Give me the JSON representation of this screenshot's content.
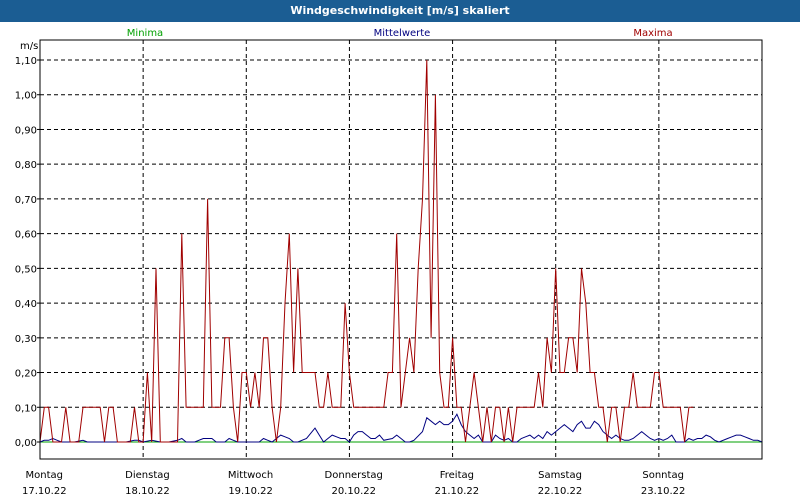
{
  "window_title": "Windgeschwindigkeit [m/s] skaliert",
  "colors": {
    "titlebar": "#1b5d93",
    "minima": "#00a000",
    "mittelwerte": "#000080",
    "maxima": "#a00000",
    "grid": "#000000"
  },
  "chart_data": {
    "type": "line",
    "title": "Windgeschwindigkeit [m/s] skaliert",
    "ylabel": "m/s",
    "ylim": [
      0,
      1.1
    ],
    "y_ticks": [
      "0,00",
      "0,10",
      "0,20",
      "0,30",
      "0,40",
      "0,50",
      "0,60",
      "0,70",
      "0,80",
      "0,90",
      "1,00",
      "1,10"
    ],
    "x_range_hours": [
      0,
      168
    ],
    "days": [
      {
        "weekday": "Montag",
        "date": "17.10.22"
      },
      {
        "weekday": "Dienstag",
        "date": "18.10.22"
      },
      {
        "weekday": "Mittwoch",
        "date": "19.10.22"
      },
      {
        "weekday": "Donnerstag",
        "date": "20.10.22"
      },
      {
        "weekday": "Freitag",
        "date": "21.10.22"
      },
      {
        "weekday": "Samstag",
        "date": "22.10.22"
      },
      {
        "weekday": "Sonntag",
        "date": "23.10.22"
      }
    ],
    "grid": true,
    "legend_position": "top",
    "series": [
      {
        "name": "Minima",
        "color": "#00a000",
        "points": [
          [
            0,
            0
          ],
          [
            168,
            0
          ]
        ]
      },
      {
        "name": "Mittelwerte",
        "color": "#000080",
        "points": [
          [
            0,
            0
          ],
          [
            1,
            0.005
          ],
          [
            2,
            0.005
          ],
          [
            3,
            0.01
          ],
          [
            4,
            0.005
          ],
          [
            5,
            0
          ],
          [
            8,
            0
          ],
          [
            10,
            0.005
          ],
          [
            11,
            0
          ],
          [
            20,
            0
          ],
          [
            22,
            0.005
          ],
          [
            23,
            0.005
          ],
          [
            24,
            0
          ],
          [
            26,
            0.005
          ],
          [
            28,
            0
          ],
          [
            30,
            0
          ],
          [
            32,
            0.005
          ],
          [
            33,
            0.01
          ],
          [
            34,
            0
          ],
          [
            36,
            0
          ],
          [
            38,
            0.01
          ],
          [
            40,
            0.01
          ],
          [
            41,
            0
          ],
          [
            43,
            0
          ],
          [
            44,
            0.01
          ],
          [
            45,
            0.005
          ],
          [
            46,
            0
          ],
          [
            48,
            0
          ],
          [
            51,
            0
          ],
          [
            52,
            0.01
          ],
          [
            53,
            0.005
          ],
          [
            54,
            0
          ],
          [
            55,
            0.01
          ],
          [
            56,
            0.02
          ],
          [
            57,
            0.015
          ],
          [
            58,
            0.01
          ],
          [
            59,
            0
          ],
          [
            60,
            0
          ],
          [
            62,
            0.01
          ],
          [
            64,
            0.04
          ],
          [
            65,
            0.02
          ],
          [
            66,
            0
          ],
          [
            67,
            0.01
          ],
          [
            68,
            0.02
          ],
          [
            69,
            0.015
          ],
          [
            70,
            0.01
          ],
          [
            71,
            0.01
          ],
          [
            72,
            0
          ],
          [
            73,
            0.02
          ],
          [
            74,
            0.03
          ],
          [
            75,
            0.03
          ],
          [
            76,
            0.02
          ],
          [
            77,
            0.01
          ],
          [
            78,
            0.01
          ],
          [
            79,
            0.02
          ],
          [
            80,
            0.005
          ],
          [
            82,
            0.01
          ],
          [
            83,
            0.02
          ],
          [
            84,
            0.01
          ],
          [
            85,
            0
          ],
          [
            86,
            0
          ],
          [
            87,
            0.005
          ],
          [
            89,
            0.03
          ],
          [
            90,
            0.07
          ],
          [
            91,
            0.06
          ],
          [
            92,
            0.05
          ],
          [
            93,
            0.06
          ],
          [
            94,
            0.05
          ],
          [
            95,
            0.05
          ],
          [
            96,
            0.06
          ],
          [
            97,
            0.08
          ],
          [
            98,
            0.05
          ],
          [
            99,
            0.03
          ],
          [
            100,
            0.02
          ],
          [
            101,
            0.01
          ],
          [
            102,
            0.02
          ],
          [
            103,
            0
          ],
          [
            105,
            0
          ],
          [
            106,
            0.02
          ],
          [
            107,
            0.01
          ],
          [
            108,
            0.005
          ],
          [
            109,
            0.01
          ],
          [
            110,
            0
          ],
          [
            111,
            0
          ],
          [
            112,
            0.01
          ],
          [
            113,
            0.015
          ],
          [
            114,
            0.02
          ],
          [
            115,
            0.01
          ],
          [
            116,
            0.02
          ],
          [
            117,
            0.01
          ],
          [
            118,
            0.03
          ],
          [
            119,
            0.02
          ],
          [
            120,
            0.03
          ],
          [
            121,
            0.04
          ],
          [
            122,
            0.05
          ],
          [
            123,
            0.04
          ],
          [
            124,
            0.03
          ],
          [
            125,
            0.05
          ],
          [
            126,
            0.06
          ],
          [
            127,
            0.04
          ],
          [
            128,
            0.04
          ],
          [
            129,
            0.06
          ],
          [
            130,
            0.05
          ],
          [
            131,
            0.03
          ],
          [
            132,
            0.02
          ],
          [
            133,
            0.01
          ],
          [
            134,
            0.02
          ],
          [
            135,
            0.01
          ],
          [
            136,
            0.005
          ],
          [
            137,
            0.005
          ],
          [
            138,
            0.01
          ],
          [
            139,
            0.02
          ],
          [
            140,
            0.03
          ],
          [
            141,
            0.02
          ],
          [
            142,
            0.01
          ],
          [
            143,
            0.005
          ],
          [
            144,
            0.01
          ],
          [
            145,
            0.005
          ],
          [
            146,
            0.01
          ],
          [
            147,
            0.02
          ],
          [
            148,
            0
          ],
          [
            150,
            0
          ],
          [
            151,
            0.01
          ],
          [
            152,
            0.005
          ],
          [
            153,
            0.01
          ],
          [
            154,
            0.01
          ],
          [
            155,
            0.02
          ],
          [
            156,
            0.015
          ],
          [
            157,
            0.005
          ],
          [
            158,
            0
          ],
          [
            160,
            0.01
          ],
          [
            161,
            0.015
          ],
          [
            162,
            0.02
          ],
          [
            163,
            0.02
          ],
          [
            164,
            0.015
          ],
          [
            165,
            0.01
          ],
          [
            166,
            0.005
          ],
          [
            167,
            0.005
          ],
          [
            168,
            0
          ]
        ]
      },
      {
        "name": "Maxima",
        "color": "#a00000",
        "points": [
          [
            0,
            0
          ],
          [
            1,
            0.1
          ],
          [
            2,
            0.1
          ],
          [
            3,
            0
          ],
          [
            5,
            0
          ],
          [
            6,
            0.1
          ],
          [
            7,
            0
          ],
          [
            9,
            0
          ],
          [
            10,
            0.1
          ],
          [
            11,
            0.1
          ],
          [
            12,
            0.1
          ],
          [
            13,
            0.1
          ],
          [
            14,
            0.1
          ],
          [
            15,
            0
          ],
          [
            16,
            0.1
          ],
          [
            17,
            0.1
          ],
          [
            18,
            0
          ],
          [
            19,
            0
          ],
          [
            21,
            0
          ],
          [
            22,
            0.1
          ],
          [
            23,
            0
          ],
          [
            24,
            0
          ],
          [
            25,
            0.2
          ],
          [
            26,
            0
          ],
          [
            27,
            0.5
          ],
          [
            28,
            0
          ],
          [
            29,
            0
          ],
          [
            30,
            0
          ],
          [
            32,
            0
          ],
          [
            33,
            0.6
          ],
          [
            34,
            0.1
          ],
          [
            35,
            0.1
          ],
          [
            36,
            0.1
          ],
          [
            37,
            0.1
          ],
          [
            38,
            0.1
          ],
          [
            39,
            0.7
          ],
          [
            40,
            0.1
          ],
          [
            41,
            0.1
          ],
          [
            42,
            0.1
          ],
          [
            43,
            0.3
          ],
          [
            44,
            0.3
          ],
          [
            45,
            0.1
          ],
          [
            46,
            0
          ],
          [
            47,
            0.2
          ],
          [
            48,
            0.2
          ],
          [
            49,
            0.1
          ],
          [
            50,
            0.2
          ],
          [
            51,
            0.1
          ],
          [
            52,
            0.3
          ],
          [
            53,
            0.3
          ],
          [
            54,
            0.1
          ],
          [
            55,
            0
          ],
          [
            56,
            0.1
          ],
          [
            57,
            0.4
          ],
          [
            58,
            0.6
          ],
          [
            59,
            0.2
          ],
          [
            60,
            0.5
          ],
          [
            61,
            0.2
          ],
          [
            62,
            0.2
          ],
          [
            63,
            0.2
          ],
          [
            64,
            0.2
          ],
          [
            65,
            0.1
          ],
          [
            66,
            0.1
          ],
          [
            67,
            0.2
          ],
          [
            68,
            0.1
          ],
          [
            69,
            0.1
          ],
          [
            70,
            0.1
          ],
          [
            71,
            0.4
          ],
          [
            72,
            0.2
          ],
          [
            73,
            0.1
          ],
          [
            74,
            0.1
          ],
          [
            75,
            0.1
          ],
          [
            76,
            0.1
          ],
          [
            77,
            0.1
          ],
          [
            78,
            0.1
          ],
          [
            79,
            0.1
          ],
          [
            80,
            0.1
          ],
          [
            81,
            0.2
          ],
          [
            82,
            0.2
          ],
          [
            83,
            0.6
          ],
          [
            84,
            0.1
          ],
          [
            85,
            0.2
          ],
          [
            86,
            0.3
          ],
          [
            87,
            0.2
          ],
          [
            88,
            0.5
          ],
          [
            89,
            0.7
          ],
          [
            90,
            1.1
          ],
          [
            91,
            0.3
          ],
          [
            92,
            1.0
          ],
          [
            93,
            0.2
          ],
          [
            94,
            0.1
          ],
          [
            95,
            0.1
          ],
          [
            96,
            0.3
          ],
          [
            97,
            0.1
          ],
          [
            98,
            0.1
          ],
          [
            99,
            0
          ],
          [
            100,
            0.1
          ],
          [
            101,
            0.2
          ],
          [
            102,
            0.1
          ],
          [
            103,
            0
          ],
          [
            104,
            0.1
          ],
          [
            105,
            0
          ],
          [
            106,
            0.1
          ],
          [
            107,
            0.1
          ],
          [
            108,
            0
          ],
          [
            109,
            0.1
          ],
          [
            110,
            0
          ],
          [
            111,
            0.1
          ],
          [
            112,
            0.1
          ],
          [
            113,
            0.1
          ],
          [
            114,
            0.1
          ],
          [
            115,
            0.1
          ],
          [
            116,
            0.2
          ],
          [
            117,
            0.1
          ],
          [
            118,
            0.3
          ],
          [
            119,
            0.2
          ],
          [
            120,
            0.5
          ],
          [
            121,
            0.2
          ],
          [
            122,
            0.2
          ],
          [
            123,
            0.3
          ],
          [
            124,
            0.3
          ],
          [
            125,
            0.2
          ],
          [
            126,
            0.5
          ],
          [
            127,
            0.4
          ],
          [
            128,
            0.2
          ],
          [
            129,
            0.2
          ],
          [
            130,
            0.1
          ],
          [
            131,
            0.1
          ],
          [
            132,
            0
          ],
          [
            133,
            0.1
          ],
          [
            134,
            0.1
          ],
          [
            135,
            0
          ],
          [
            136,
            0.1
          ],
          [
            137,
            0.1
          ],
          [
            138,
            0.2
          ],
          [
            139,
            0.1
          ],
          [
            140,
            0.1
          ],
          [
            141,
            0.1
          ],
          [
            142,
            0.1
          ],
          [
            143,
            0.2
          ],
          [
            144,
            0.2
          ],
          [
            145,
            0.1
          ],
          [
            146,
            0.1
          ],
          [
            147,
            0.1
          ],
          [
            148,
            0.1
          ],
          [
            149,
            0.1
          ],
          [
            150,
            0
          ],
          [
            151,
            0.1
          ],
          [
            152,
            0.1
          ]
        ]
      }
    ]
  }
}
